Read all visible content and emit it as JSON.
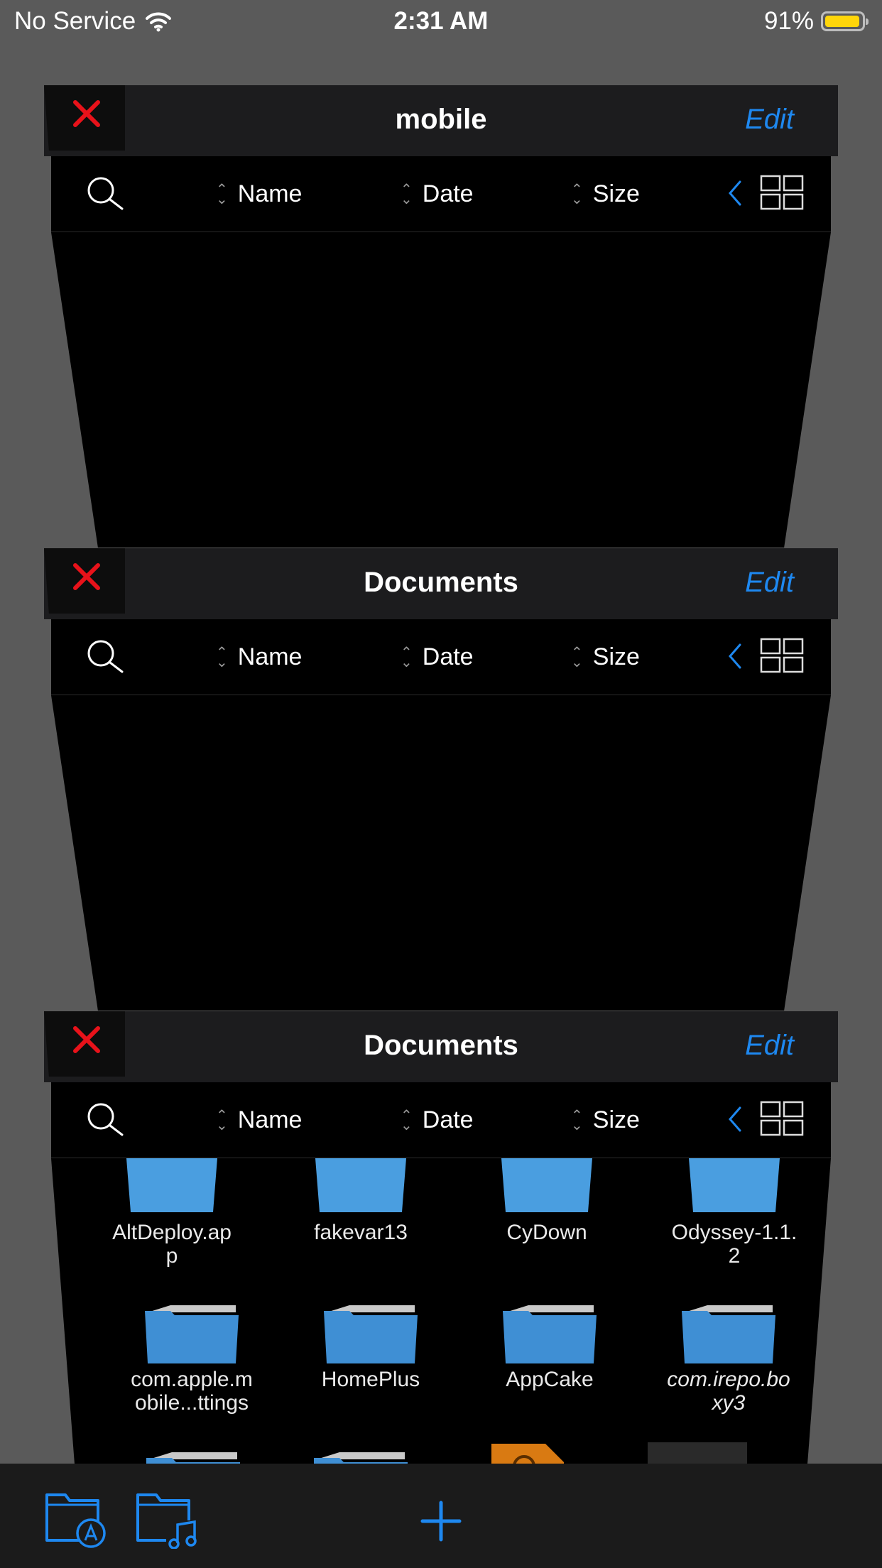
{
  "status_bar": {
    "carrier": "No Service",
    "time": "2:31 AM",
    "battery": "91%",
    "battery_level": 0.91
  },
  "windows": [
    {
      "title": "mobile",
      "edit_label": "Edit",
      "columns": [
        "Name",
        "Date",
        "Size"
      ]
    },
    {
      "title": "Documents",
      "edit_label": "Edit",
      "columns": [
        "Name",
        "Date",
        "Size"
      ]
    },
    {
      "title": "Documents",
      "edit_label": "Edit",
      "columns": [
        "Name",
        "Date",
        "Size"
      ],
      "files": [
        {
          "name": "AltDeploy.ap\np"
        },
        {
          "name": "fakevar13"
        },
        {
          "name": "CyDown"
        },
        {
          "name": "Odyssey-1.1.\n2"
        },
        {
          "name": "com.apple.m\nobile...ttings"
        },
        {
          "name": "HomePlus"
        },
        {
          "name": "AppCake"
        },
        {
          "name": "com.irepo.bo\nxy3"
        }
      ]
    }
  ],
  "colors": {
    "accent": "#1e88f0",
    "close": "#e8121a",
    "folder": "#4a9ee0",
    "battery": "#ffd60a"
  },
  "icons": {
    "close": "close-x-icon",
    "search": "search-icon",
    "sort": "sort-arrows-icon",
    "back": "chevron-left-icon",
    "grid": "grid-view-icon",
    "bottom_left": "folder-apps-icon",
    "bottom_second": "folder-music-icon",
    "bottom_center": "plus-icon"
  }
}
